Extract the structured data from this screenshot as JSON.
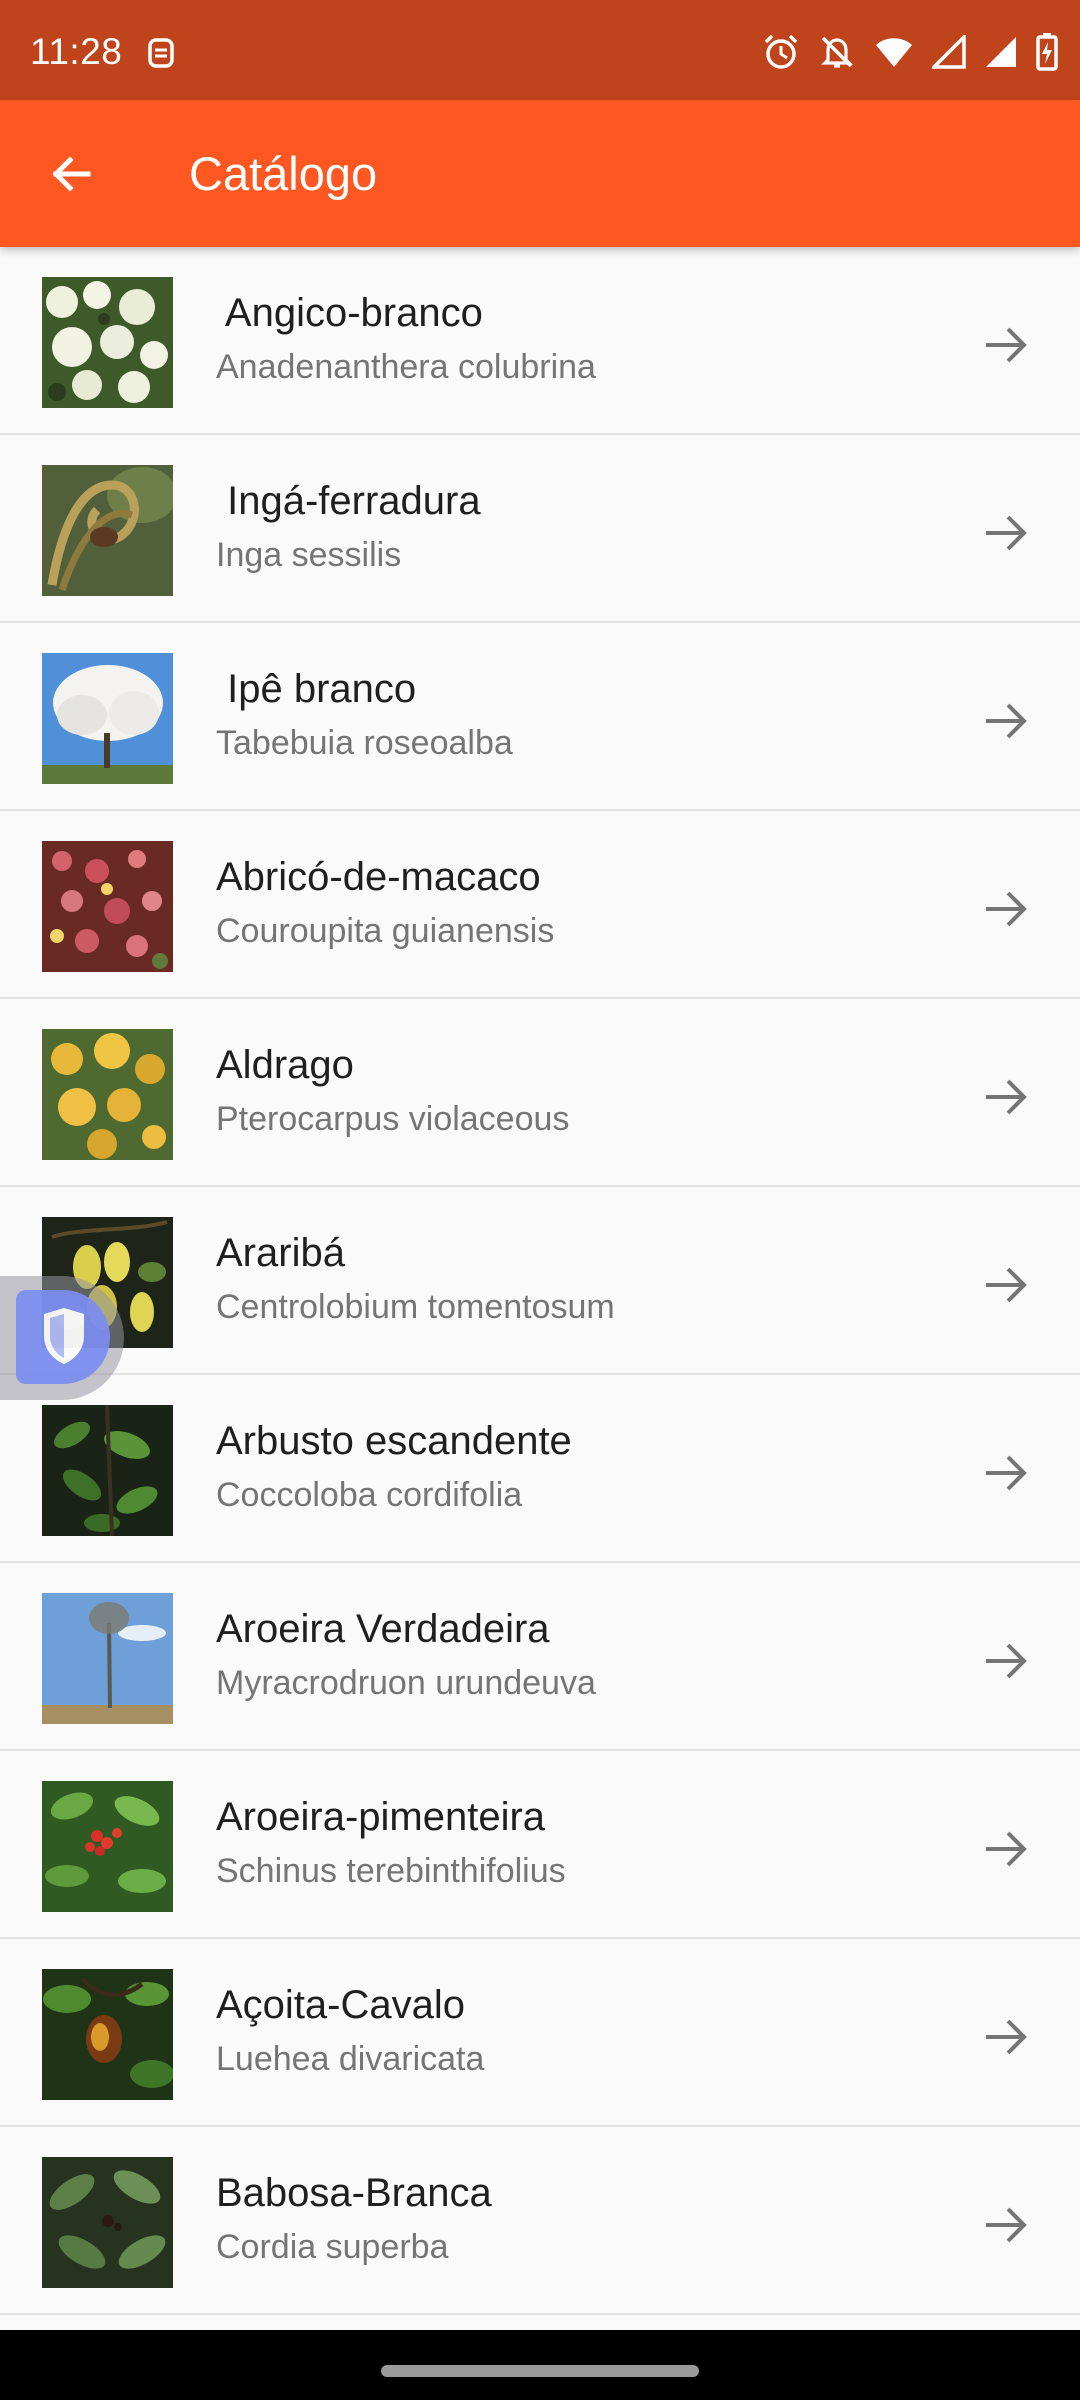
{
  "status_bar": {
    "time": "11:28",
    "left_icon": "screen-record-icon",
    "right_icons": [
      "alarm-icon",
      "notifications-off-icon",
      "wifi-icon",
      "signal-empty-icon",
      "signal-full-icon",
      "battery-charging-icon"
    ]
  },
  "app_bar": {
    "title": "Catálogo",
    "back_icon": "arrow-back-icon"
  },
  "colors": {
    "status_bar": "#bf431b",
    "app_bar": "#ff5722",
    "background": "#fafafa",
    "title_text": "#1f1f1f",
    "subtitle_text": "#757575"
  },
  "items": [
    {
      "title": " Angico-branco",
      "subtitle": "Anadenanthera colubrina"
    },
    {
      "title": " Ingá-ferradura",
      "subtitle": "Inga sessilis"
    },
    {
      "title": " Ipê branco",
      "subtitle": "Tabebuia roseoalba"
    },
    {
      "title": "Abricó-de-macaco",
      "subtitle": "Couroupita guianensis"
    },
    {
      "title": "Aldrago",
      "subtitle": "Pterocarpus violaceous"
    },
    {
      "title": "Araribá",
      "subtitle": "Centrolobium tomentosum"
    },
    {
      "title": "Arbusto escandente",
      "subtitle": "Coccoloba cordifolia"
    },
    {
      "title": "Aroeira Verdadeira",
      "subtitle": "Myracrodruon urundeuva"
    },
    {
      "title": "Aroeira-pimenteira",
      "subtitle": "Schinus terebinthifolius"
    },
    {
      "title": "Açoita-Cavalo",
      "subtitle": "Luehea divaricata"
    },
    {
      "title": "Babosa-Branca",
      "subtitle": "Cordia superba"
    }
  ]
}
